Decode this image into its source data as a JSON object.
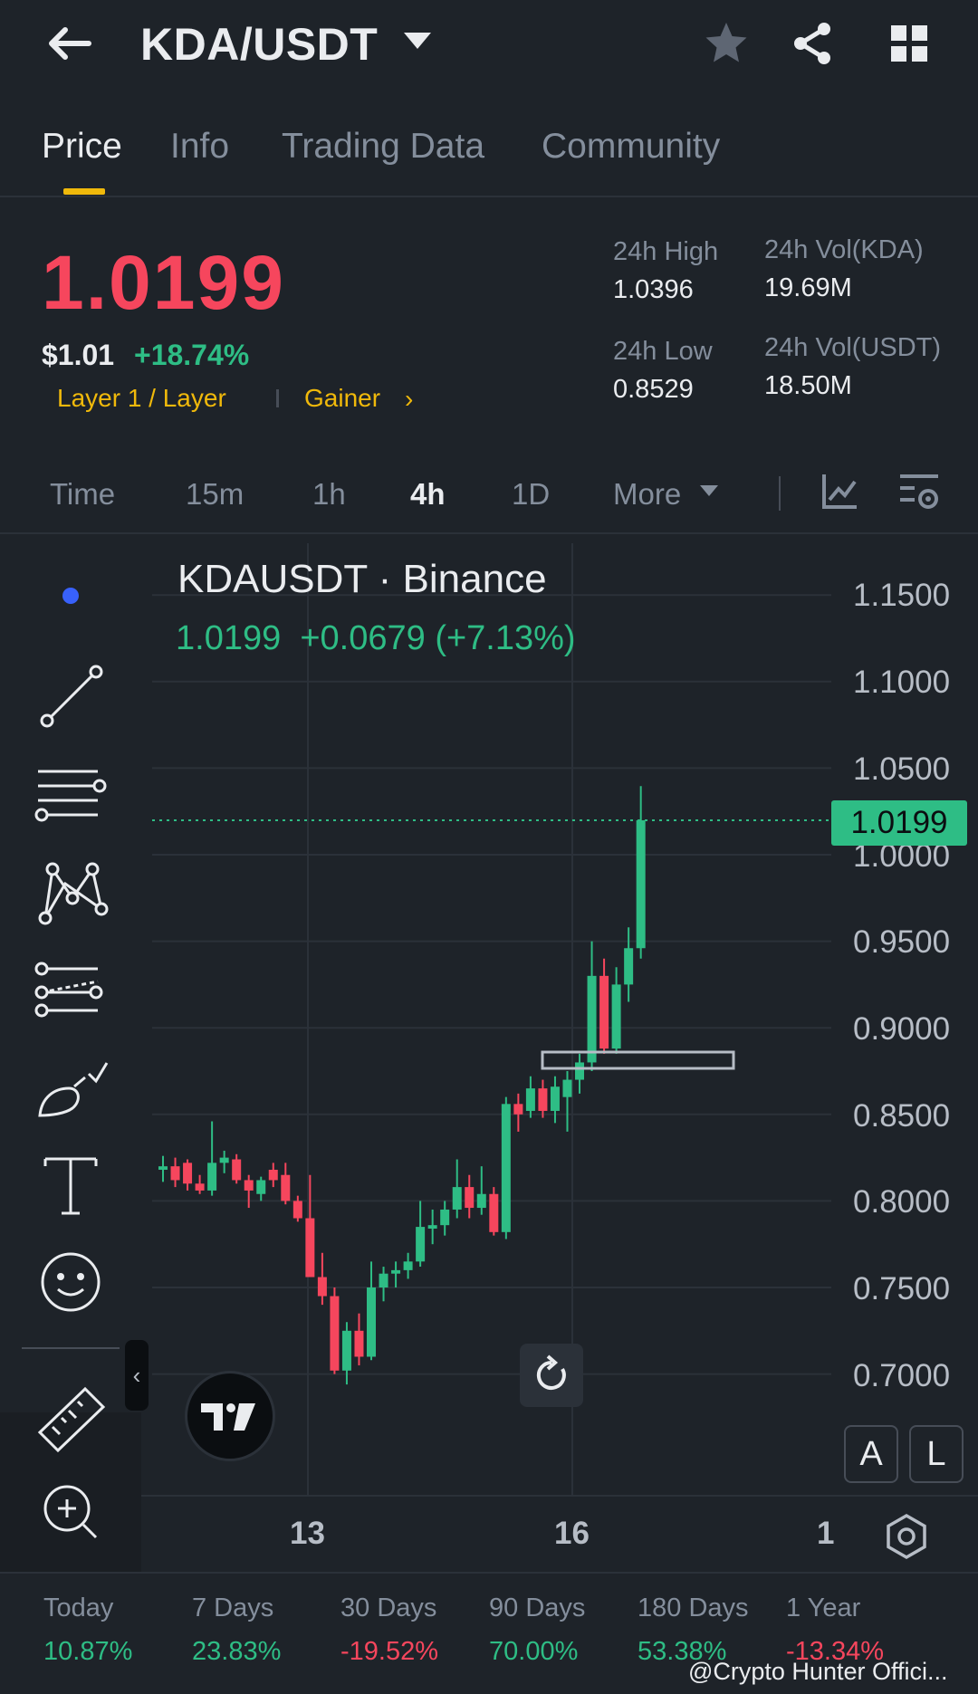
{
  "header": {
    "pair": "KDA/USDT"
  },
  "tabs": [
    {
      "label": "Price",
      "active": true
    },
    {
      "label": "Info",
      "active": false
    },
    {
      "label": "Trading Data",
      "active": false
    },
    {
      "label": "Community",
      "active": false
    }
  ],
  "ticker": {
    "last_price": "1.0199",
    "usd_price": "$1.01",
    "change_pct": "+18.74%",
    "tag_category": "Layer 1 / Layer",
    "tag_gainer": "Gainer",
    "high_label": "24h High",
    "high_value": "1.0396",
    "low_label": "24h Low",
    "low_value": "0.8529",
    "vol_base_label": "24h Vol(KDA)",
    "vol_base_value": "19.69M",
    "vol_quote_label": "24h Vol(USDT)",
    "vol_quote_value": "18.50M"
  },
  "intervals": [
    {
      "label": "Time",
      "active": false
    },
    {
      "label": "15m",
      "active": false
    },
    {
      "label": "1h",
      "active": false
    },
    {
      "label": "4h",
      "active": true
    },
    {
      "label": "1D",
      "active": false
    },
    {
      "label": "More",
      "active": false
    }
  ],
  "chart": {
    "symbol_line": "KDAUSDT · Binance",
    "ohlc_line": "1.0199  +0.0679 (+7.13%)",
    "last_price_tag": "1.0199",
    "price_ticks": [
      "1.1500",
      "1.1000",
      "1.0500",
      "1.0000",
      "0.9500",
      "0.9000",
      "0.8500",
      "0.8000",
      "0.7500",
      "0.7000"
    ],
    "time_ticks": [
      "13",
      "16",
      "1"
    ],
    "a_button": "A",
    "l_button": "L",
    "colors": {
      "up": "#2ebd85",
      "down": "#f6465d",
      "grid": "#2b3139"
    }
  },
  "chart_data": {
    "type": "candlestick",
    "title": "KDAUSDT · Binance",
    "xlabel": "",
    "ylabel": "",
    "ylim": [
      0.65,
      1.17
    ],
    "x_ticks": [
      "13",
      "16",
      "1"
    ],
    "grid": true,
    "last_price": 1.0199,
    "candles": [
      {
        "o": 0.818,
        "h": 0.826,
        "l": 0.811,
        "c": 0.82
      },
      {
        "o": 0.82,
        "h": 0.825,
        "l": 0.808,
        "c": 0.812
      },
      {
        "o": 0.822,
        "h": 0.824,
        "l": 0.806,
        "c": 0.81
      },
      {
        "o": 0.81,
        "h": 0.815,
        "l": 0.804,
        "c": 0.806
      },
      {
        "o": 0.806,
        "h": 0.846,
        "l": 0.803,
        "c": 0.822
      },
      {
        "o": 0.822,
        "h": 0.829,
        "l": 0.816,
        "c": 0.825
      },
      {
        "o": 0.824,
        "h": 0.827,
        "l": 0.81,
        "c": 0.812
      },
      {
        "o": 0.812,
        "h": 0.815,
        "l": 0.796,
        "c": 0.806
      },
      {
        "o": 0.804,
        "h": 0.814,
        "l": 0.8,
        "c": 0.812
      },
      {
        "o": 0.818,
        "h": 0.822,
        "l": 0.808,
        "c": 0.812
      },
      {
        "o": 0.815,
        "h": 0.822,
        "l": 0.798,
        "c": 0.8
      },
      {
        "o": 0.8,
        "h": 0.803,
        "l": 0.788,
        "c": 0.79
      },
      {
        "o": 0.79,
        "h": 0.815,
        "l": 0.765,
        "c": 0.756
      },
      {
        "o": 0.756,
        "h": 0.77,
        "l": 0.74,
        "c": 0.745
      },
      {
        "o": 0.745,
        "h": 0.75,
        "l": 0.7,
        "c": 0.702
      },
      {
        "o": 0.702,
        "h": 0.73,
        "l": 0.694,
        "c": 0.725
      },
      {
        "o": 0.725,
        "h": 0.735,
        "l": 0.705,
        "c": 0.71
      },
      {
        "o": 0.71,
        "h": 0.765,
        "l": 0.708,
        "c": 0.75
      },
      {
        "o": 0.75,
        "h": 0.762,
        "l": 0.742,
        "c": 0.758
      },
      {
        "o": 0.758,
        "h": 0.765,
        "l": 0.75,
        "c": 0.76
      },
      {
        "o": 0.76,
        "h": 0.77,
        "l": 0.755,
        "c": 0.765
      },
      {
        "o": 0.765,
        "h": 0.8,
        "l": 0.762,
        "c": 0.785
      },
      {
        "o": 0.784,
        "h": 0.795,
        "l": 0.775,
        "c": 0.786
      },
      {
        "o": 0.786,
        "h": 0.8,
        "l": 0.78,
        "c": 0.795
      },
      {
        "o": 0.795,
        "h": 0.824,
        "l": 0.79,
        "c": 0.808
      },
      {
        "o": 0.808,
        "h": 0.815,
        "l": 0.79,
        "c": 0.796
      },
      {
        "o": 0.796,
        "h": 0.82,
        "l": 0.792,
        "c": 0.804
      },
      {
        "o": 0.804,
        "h": 0.808,
        "l": 0.78,
        "c": 0.782
      },
      {
        "o": 0.782,
        "h": 0.86,
        "l": 0.778,
        "c": 0.856
      },
      {
        "o": 0.856,
        "h": 0.862,
        "l": 0.84,
        "c": 0.85
      },
      {
        "o": 0.852,
        "h": 0.872,
        "l": 0.848,
        "c": 0.865
      },
      {
        "o": 0.865,
        "h": 0.87,
        "l": 0.848,
        "c": 0.852
      },
      {
        "o": 0.852,
        "h": 0.872,
        "l": 0.845,
        "c": 0.866
      },
      {
        "o": 0.86,
        "h": 0.875,
        "l": 0.84,
        "c": 0.87
      },
      {
        "o": 0.87,
        "h": 0.885,
        "l": 0.862,
        "c": 0.88
      },
      {
        "o": 0.88,
        "h": 0.95,
        "l": 0.875,
        "c": 0.93
      },
      {
        "o": 0.93,
        "h": 0.94,
        "l": 0.885,
        "c": 0.888
      },
      {
        "o": 0.888,
        "h": 0.935,
        "l": 0.885,
        "c": 0.925
      },
      {
        "o": 0.925,
        "h": 0.958,
        "l": 0.915,
        "c": 0.946
      },
      {
        "o": 0.946,
        "h": 1.0396,
        "l": 0.94,
        "c": 1.0199
      }
    ]
  },
  "performance": [
    {
      "label": "Today",
      "value": "10.87%",
      "direction": "up"
    },
    {
      "label": "7 Days",
      "value": "23.83%",
      "direction": "up"
    },
    {
      "label": "30 Days",
      "value": "-19.52%",
      "direction": "down"
    },
    {
      "label": "90 Days",
      "value": "70.00%",
      "direction": "up"
    },
    {
      "label": "180 Days",
      "value": "53.38%",
      "direction": "up"
    },
    {
      "label": "1 Year",
      "value": "-13.34%",
      "direction": "down"
    }
  ],
  "watermark": "@Crypto  Hunter Offici...",
  "icons": {
    "back": "arrow-left-icon",
    "dropdown": "caret-down-icon",
    "favorite": "star-icon",
    "share": "share-icon",
    "menu": "grid-icon"
  }
}
